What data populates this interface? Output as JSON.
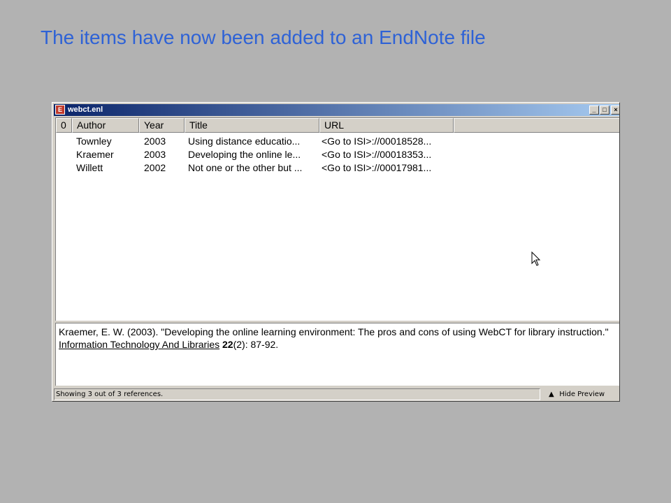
{
  "slide": {
    "title": "The items have now been added to an EndNote file"
  },
  "window": {
    "title": "webct.enl",
    "buttons": {
      "minimize": "_",
      "maximize": "□",
      "close": "×"
    }
  },
  "list": {
    "columns": [
      "",
      "Author",
      "Year",
      "Title",
      "URL"
    ],
    "attachment_icon": "0",
    "rows": [
      {
        "author": "Townley",
        "year": "2003",
        "title": "Using distance educatio...",
        "url": "<Go to ISI>://00018528..."
      },
      {
        "author": "Kraemer",
        "year": "2003",
        "title": "Developing the online le...",
        "url": "<Go to ISI>://00018353..."
      },
      {
        "author": "Willett",
        "year": "2002",
        "title": "Not one or the other but ...",
        "url": "<Go to ISI>://00017981..."
      }
    ]
  },
  "preview": {
    "text_before": "Kraemer, E. W. (2003). \"Developing the online learning environment: The pros and cons of using WebCT for library instruction.\" ",
    "journal": "Information Technology And Libraries",
    "space": " ",
    "volume": "22",
    "text_after": "(2): 87-92."
  },
  "status": {
    "text": "Showing 3 out of 3 references.",
    "hide_preview_label": "Hide Preview"
  },
  "icons": {
    "app": "endnote-icon",
    "hide_preview": "double-chevron-up-icon",
    "cursor": "mouse-pointer-icon"
  }
}
